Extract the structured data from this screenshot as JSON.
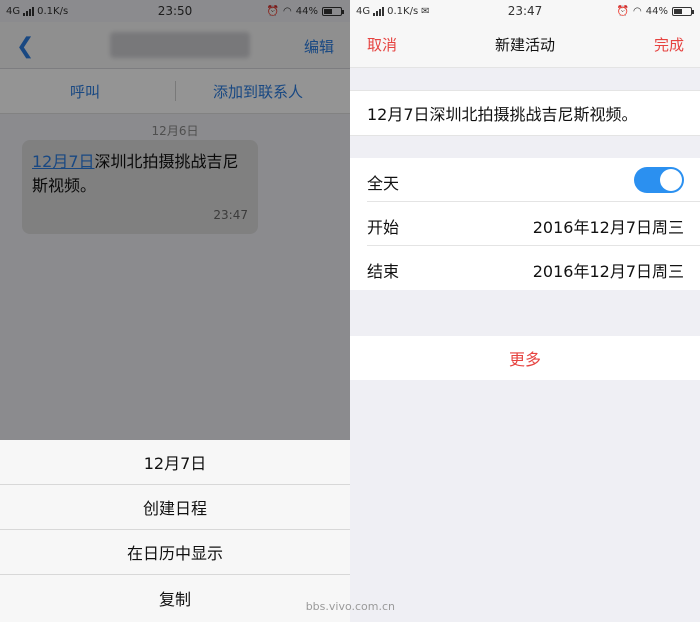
{
  "left": {
    "status": {
      "network": "4G",
      "speed": "0.1K/s",
      "time": "23:50",
      "battery": "44%",
      "battery_level": 0.44
    },
    "nav": {
      "edit": "编辑"
    },
    "actions": {
      "call": "呼叫",
      "add_contact": "添加到联系人"
    },
    "message": {
      "date": "12月6日",
      "link_text": "12月7日",
      "text": "深圳北拍摄挑战吉尼斯视频。",
      "time": "23:47"
    },
    "sheet": {
      "options": [
        "12月7日",
        "创建日程",
        "在日历中显示",
        "复制"
      ]
    }
  },
  "right": {
    "status": {
      "network": "4G",
      "speed": "0.1K/s",
      "time": "23:47",
      "battery": "44%",
      "battery_level": 0.44
    },
    "nav": {
      "cancel": "取消",
      "title": "新建活动",
      "done": "完成"
    },
    "event_title": "12月7日深圳北拍摄挑战吉尼斯视频。",
    "all_day": {
      "label": "全天",
      "on": true
    },
    "start": {
      "label": "开始",
      "value": "2016年12月7日周三"
    },
    "end": {
      "label": "结束",
      "value": "2016年12月7日周三"
    },
    "more": "更多"
  },
  "watermark": "bbs.vivo.com.cn",
  "colors": {
    "link_blue": "#2b7de1",
    "accent_red": "#e64340",
    "toggle_blue": "#2b90f0"
  }
}
